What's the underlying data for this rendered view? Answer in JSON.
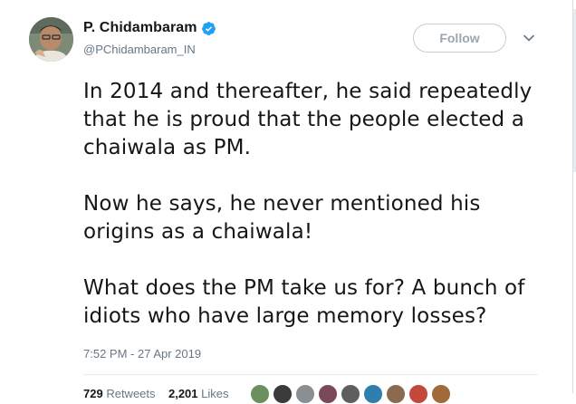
{
  "author": {
    "name": "P. Chidambaram",
    "handle": "@PChidambaram_IN",
    "verified": true
  },
  "follow_button": {
    "label": "Follow"
  },
  "tweet": {
    "paragraphs": [
      "In 2014 and thereafter, he said repeatedly that he is proud that the people elected a chaiwala as PM.",
      "Now he says, he never mentioned his origins as a chaiwala!",
      "What does the PM take us for? A bunch of idiots who have large memory losses?"
    ],
    "timestamp": "7:52 PM - 27 Apr 2019"
  },
  "stats": {
    "retweets_count": "729",
    "retweets_label": "Retweets",
    "likes_count": "2,201",
    "likes_label": "Likes"
  },
  "colors": {
    "accent": "#1da1f2",
    "text_primary": "#14171a",
    "text_secondary": "#657786",
    "border": "#e6ecf0"
  },
  "likers": [
    {
      "color": "#6b8f5e"
    },
    {
      "color": "#3b3b3b"
    },
    {
      "color": "#8a8f94"
    },
    {
      "color": "#7a4a5a"
    },
    {
      "color": "#5e5e5e"
    },
    {
      "color": "#2f7fae"
    },
    {
      "color": "#8c6a4f"
    },
    {
      "color": "#c4483b"
    },
    {
      "color": "#a06a3a"
    }
  ]
}
